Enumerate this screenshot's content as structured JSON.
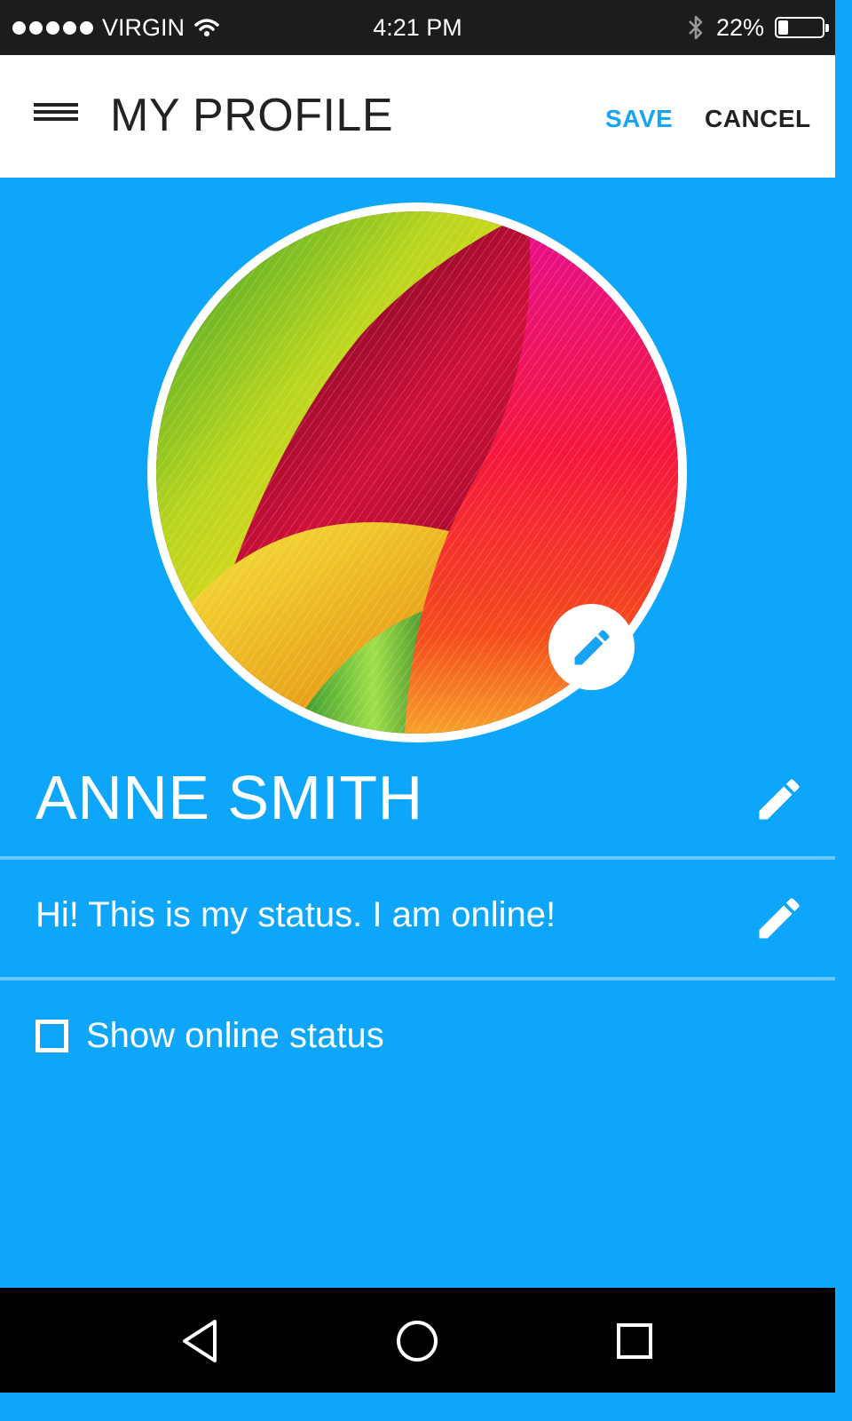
{
  "status_bar": {
    "carrier": "VIRGIN",
    "time": "4:21 PM",
    "battery_text": "22%",
    "battery_level": 0.22,
    "icons": [
      "signal-dots-icon",
      "wifi-icon",
      "bluetooth-icon",
      "battery-icon"
    ]
  },
  "app_bar": {
    "title": "MY PROFILE",
    "save_label": "SAVE",
    "cancel_label": "CANCEL",
    "menu_icon": "hamburger-menu-icon"
  },
  "profile": {
    "name": "ANNE SMITH",
    "status": "Hi! This is my status. I am online!",
    "show_online_label": "Show online status",
    "show_online_checked": false,
    "edit_icon": "pencil-icon"
  },
  "nav_bar": {
    "icons": [
      "back-triangle-icon",
      "home-circle-icon",
      "recents-square-icon"
    ]
  },
  "colors": {
    "accent": "#17a4f2",
    "background": "#0da6fa",
    "divider": "#6cc7fb",
    "app_bar": "#ffffff",
    "status_bar": "#1c1c1e",
    "nav_bar": "#000000"
  }
}
